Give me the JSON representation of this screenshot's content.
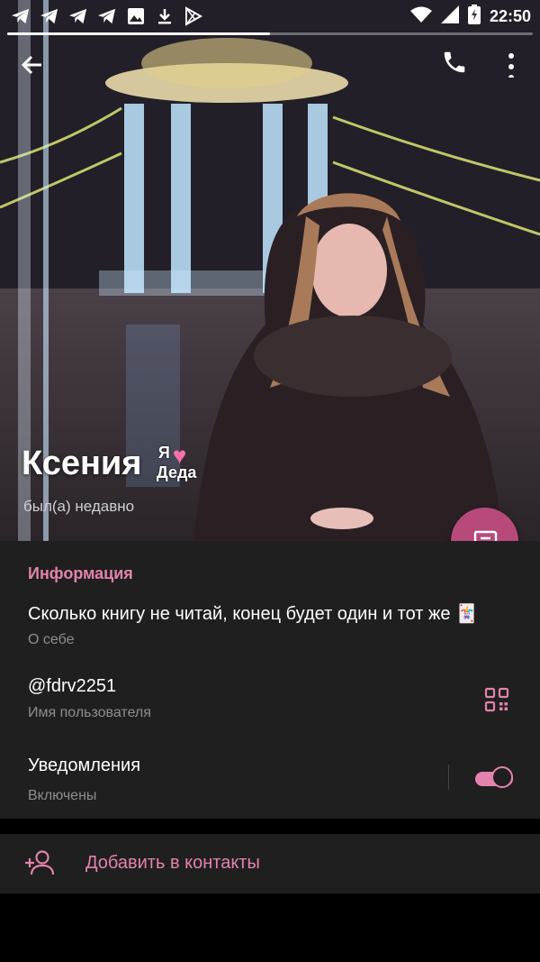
{
  "statusbar": {
    "time": "22:50",
    "icons": [
      "telegram-icon",
      "telegram-icon",
      "telegram-icon",
      "telegram-icon",
      "gallery-icon",
      "download-icon",
      "play-store-icon"
    ]
  },
  "profile": {
    "name": "Ксения",
    "badge_line1": "Я",
    "badge_line2": "Деда",
    "last_seen": "был(а) недавно"
  },
  "info": {
    "section_title": "Информация",
    "bio": "Сколько книгу не читай, конец будет один и тот же 🃏",
    "bio_label": "О себе",
    "username": "@fdrv2251",
    "username_label": "Имя пользователя",
    "notifications": "Уведомления",
    "notifications_state": "Включены",
    "notifications_on": true
  },
  "actions": {
    "add_contact": "Добавить в контакты"
  },
  "colors": {
    "accent": "#e383ad",
    "fab": "#b84a7a",
    "panel": "#1f1f1f"
  }
}
